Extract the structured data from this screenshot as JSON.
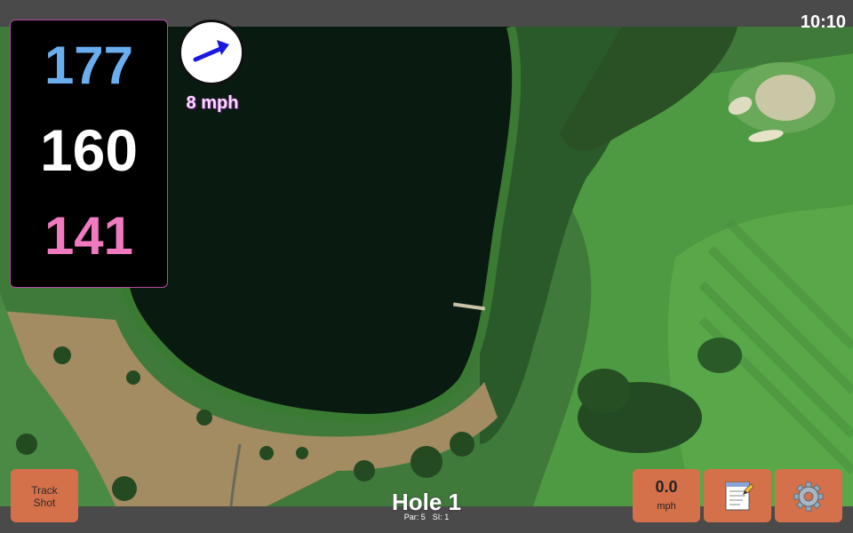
{
  "status_bar": {
    "time": "10:10"
  },
  "distances": {
    "back": "177",
    "center": "160",
    "front": "141"
  },
  "distance_colors": {
    "back": "#6aaef0",
    "center": "#ffffff",
    "front": "#f07ac0"
  },
  "wind": {
    "speed": "8 mph",
    "arrow_icon": "wind-arrow-icon",
    "arrow_color": "#1a1adf"
  },
  "buttons": {
    "track_shot": "Track\nShot",
    "speed_value": "0.0",
    "speed_unit": "mph",
    "notes_icon": "notepad-icon",
    "settings_icon": "gear-icon",
    "button_color": "#d5714a"
  },
  "hole": {
    "title": "Hole 1",
    "par": "Par: 5",
    "si": "SI: 1"
  }
}
